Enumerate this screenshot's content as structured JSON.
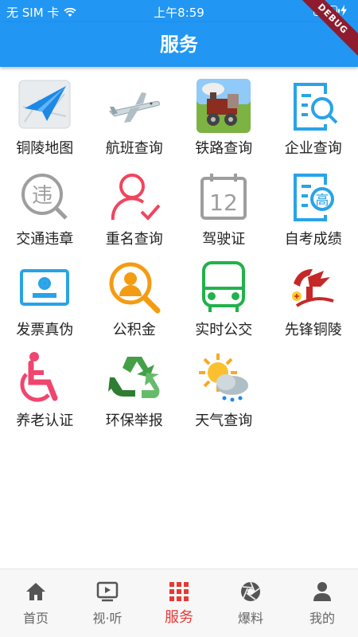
{
  "status_bar": {
    "carrier": "无 SIM 卡",
    "time": "上午8:59",
    "wifi_icon": "wifi-icon",
    "battery_icon": "battery-icon"
  },
  "app_bar": {
    "title": "服务"
  },
  "debug_banner": "DEBUG",
  "services": [
    {
      "label": "铜陵地图",
      "icon": "map-icon"
    },
    {
      "label": "航班查询",
      "icon": "airplane-icon"
    },
    {
      "label": "铁路查询",
      "icon": "train-icon"
    },
    {
      "label": "企业查询",
      "icon": "enterprise-search-icon"
    },
    {
      "label": "交通违章",
      "icon": "traffic-violation-icon"
    },
    {
      "label": "重名查询",
      "icon": "name-search-icon"
    },
    {
      "label": "驾驶证",
      "icon": "driver-license-icon"
    },
    {
      "label": "自考成绩",
      "icon": "exam-score-icon"
    },
    {
      "label": "发票真伪",
      "icon": "invoice-icon"
    },
    {
      "label": "公积金",
      "icon": "housing-fund-icon"
    },
    {
      "label": "实时公交",
      "icon": "bus-icon"
    },
    {
      "label": "先锋铜陵",
      "icon": "party-emblem-icon"
    },
    {
      "label": "养老认证",
      "icon": "wheelchair-icon"
    },
    {
      "label": "环保举报",
      "icon": "recycle-icon"
    },
    {
      "label": "天气查询",
      "icon": "weather-icon"
    }
  ],
  "icon_glyphs": {
    "traffic_violation": "违",
    "driver_license": "12",
    "exam_score": "高"
  },
  "tabs": [
    {
      "label": "首页",
      "icon": "home-icon",
      "active": false
    },
    {
      "label": "视·听",
      "icon": "video-icon",
      "active": false
    },
    {
      "label": "服务",
      "icon": "grid-icon",
      "active": true
    },
    {
      "label": "爆料",
      "icon": "camera-aperture-icon",
      "active": false
    },
    {
      "label": "我的",
      "icon": "person-icon",
      "active": false
    }
  ],
  "colors": {
    "primary": "#2196f3",
    "active_tab": "#e53935",
    "inactive_tab": "#666666",
    "line_icon_blue": "#29a3e8",
    "line_icon_red": "#f0455e",
    "line_icon_gray": "#9e9e9e",
    "bus_green": "#22b14c",
    "fund_orange": "#f39c12",
    "wheelchair_pink": "#f0456e"
  }
}
